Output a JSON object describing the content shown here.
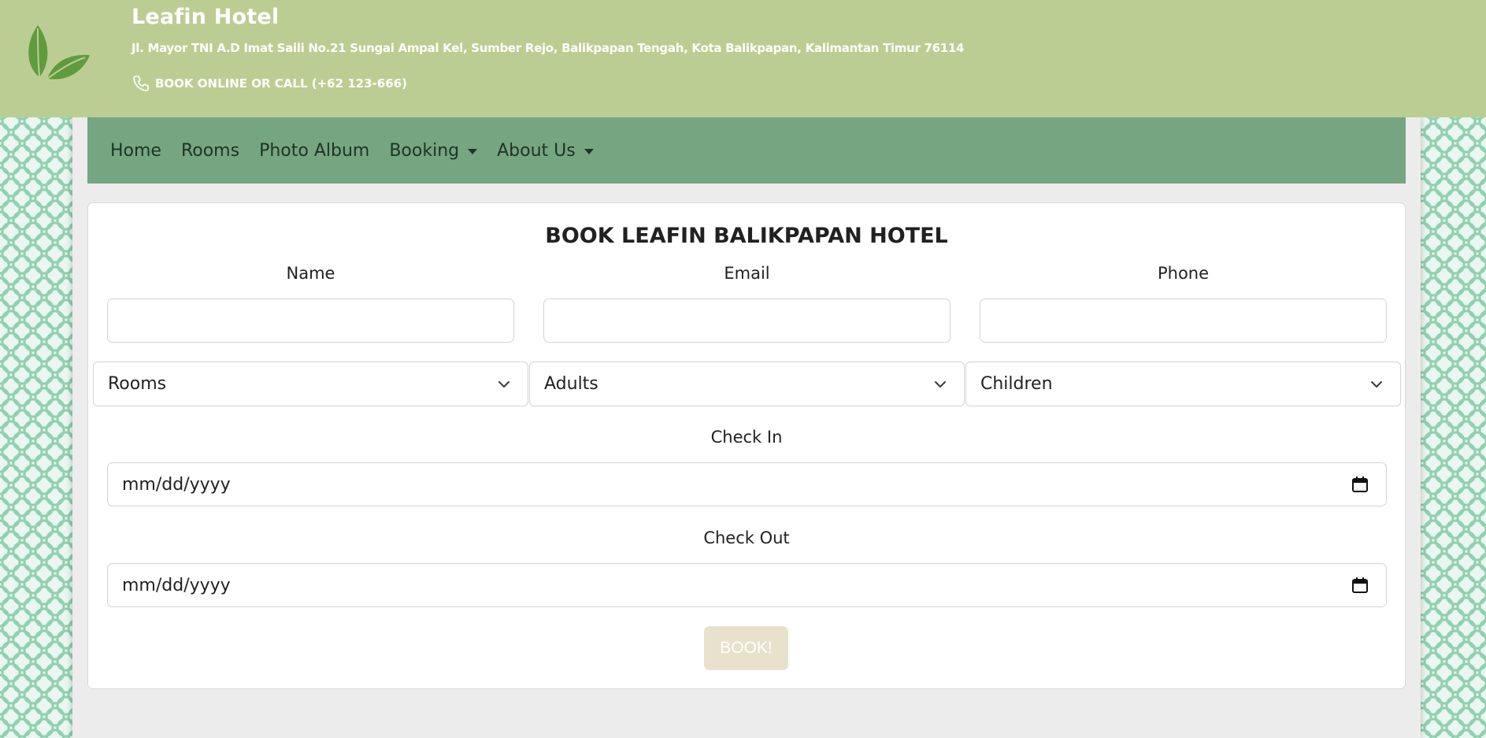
{
  "header": {
    "brand": "Leafin Hotel",
    "address": "Jl. Mayor TNI A.D Imat Saili No.21 Sungai Ampal Kel, Sumber Rejo, Balikpapan Tengah, Kota Balikpapan, Kalimantan Timur 76114",
    "call_text": "BOOK ONLINE OR CALL (+62 123-666)",
    "logo_icon": "leaf-logo-icon",
    "phone_icon": "phone-icon"
  },
  "nav": {
    "items": [
      {
        "label": "Home"
      },
      {
        "label": "Rooms"
      },
      {
        "label": "Photo Album"
      },
      {
        "label": "Booking"
      },
      {
        "label": "About Us"
      }
    ]
  },
  "form": {
    "title": "BOOK LEAFIN BALIKPAPAN HOTEL",
    "name_label": "Name",
    "email_label": "Email",
    "phone_label": "Phone",
    "rooms_select": "Rooms",
    "adults_select": "Adults",
    "children_select": "Children",
    "checkin_label": "Check In",
    "checkin_value": "mm/dd/yyyy",
    "checkout_label": "Check Out",
    "checkout_value": "mm/dd/yyyy",
    "submit_label": "BOOK!"
  },
  "colors": {
    "header_bg": "#bccd93",
    "navbar_bg": "#75a681",
    "button_bg": "#e8e1cc"
  }
}
